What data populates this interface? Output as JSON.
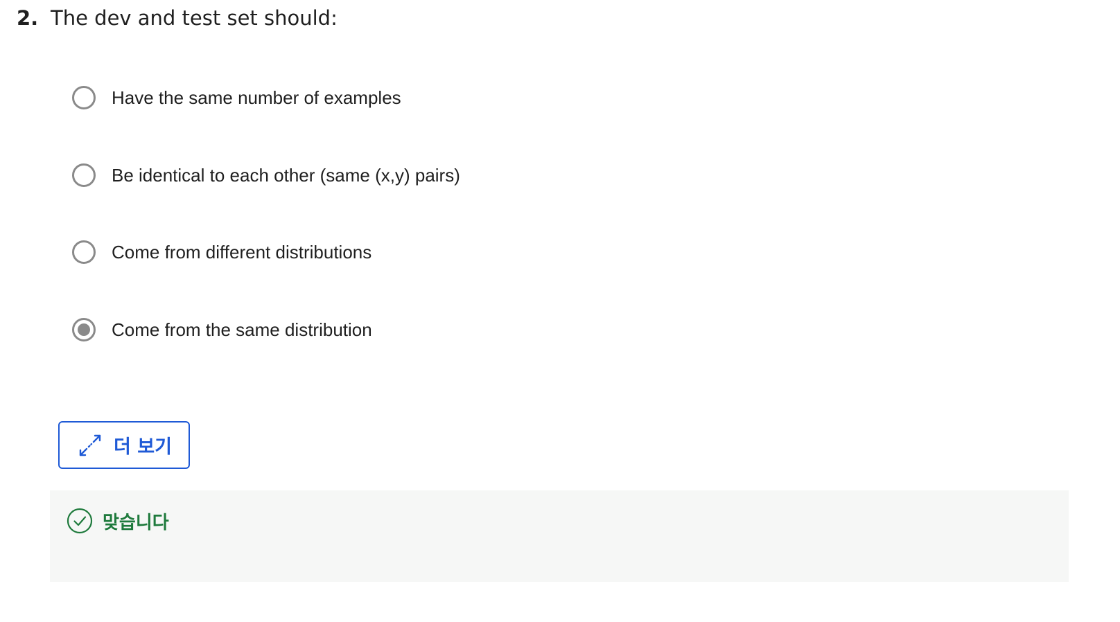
{
  "question": {
    "number": "2.",
    "text": "The dev and test set should:"
  },
  "options": [
    {
      "label": "Have the same number of examples",
      "selected": false
    },
    {
      "label": "Be identical to each other (same (x,y) pairs)",
      "selected": false
    },
    {
      "label": "Come from different distributions",
      "selected": false
    },
    {
      "label": "Come from the same distribution",
      "selected": true
    }
  ],
  "more_button": {
    "label": "더 보기",
    "icon": "expand-icon"
  },
  "feedback": {
    "icon": "check-circle-icon",
    "text": "맞습니다"
  },
  "colors": {
    "accent": "#1f5ad6",
    "correct": "#1e7a3c",
    "radio": "#8a8a8a",
    "feedback_bg": "#f6f7f6"
  }
}
